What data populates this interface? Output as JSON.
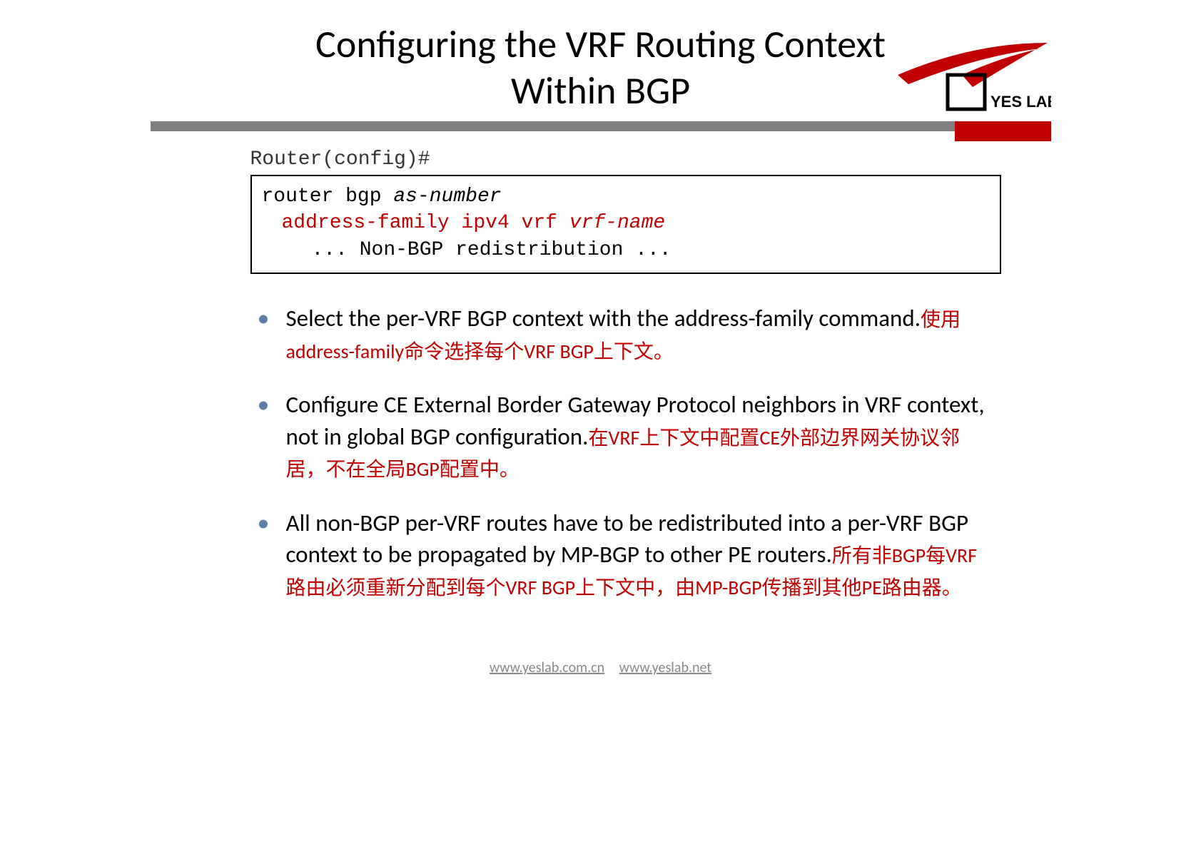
{
  "title_line1": "Configuring the VRF Routing Context",
  "title_line2": "Within BGP",
  "logo_text": "YES LAB",
  "prompt": "Router(config)#",
  "code": {
    "l1a": "router bgp ",
    "l1b": "as-number",
    "l2a": "address-family ipv4 vrf ",
    "l2b": "vrf-name",
    "l3": "... Non-BGP redistribution ..."
  },
  "bullets": {
    "b1_en_a": "Select the per-VRF BGP context with the ",
    "b1_en_b": "address-family command.",
    "b1_cn": "使用address-family命令选择每个VRF BGP上下文。",
    "b2_en": "Configure CE External Border Gateway Protocol neighbors in VRF context, not in global BGP configuration.",
    "b2_cn": "在VRF上下文中配置CE外部边界网关协议邻居，不在全局BGP配置中。",
    "b3_en": "All non-BGP per-VRF routes have to be redistributed into a per-VRF BGP context to be propagated by MP-BGP to other PE routers.",
    "b3_cn": "所有非BGP每VRF路由必须重新分配到每个VRF BGP上下文中，由MP-BGP传播到其他PE路由器。"
  },
  "footer": {
    "url1": "www.yeslab.com.cn",
    "url2": "www.yeslab.net"
  }
}
